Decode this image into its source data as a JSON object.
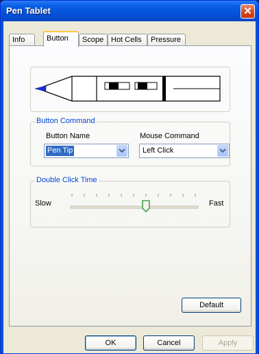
{
  "window": {
    "title": "Pen Tablet"
  },
  "tabs": [
    {
      "label": "Info"
    },
    {
      "label": "Button"
    },
    {
      "label": "Scope"
    },
    {
      "label": "Hot Cells"
    },
    {
      "label": "Pressure"
    }
  ],
  "active_tab": "Button",
  "button_command": {
    "title": "Button Command",
    "button_name_label": "Button Name",
    "button_name_value": "Pen Tip",
    "mouse_command_label": "Mouse Command",
    "mouse_command_value": "Left Click"
  },
  "double_click": {
    "title": "Double Click Time",
    "slow_label": "Slow",
    "fast_label": "Fast",
    "slider_position": 0.6,
    "tick_count": 11
  },
  "buttons": {
    "default": "Default",
    "ok": "OK",
    "cancel": "Cancel",
    "apply": "Apply"
  },
  "colors": {
    "title_bar": "#0552d8",
    "close_button": "#d64418",
    "dialog_bg": "#ece9d8",
    "group_title": "#0046d5",
    "selection": "#316ac5"
  },
  "icons": {
    "close": "close-icon",
    "dropdown": "chevron-down-icon",
    "pen": "pen-illustration"
  }
}
